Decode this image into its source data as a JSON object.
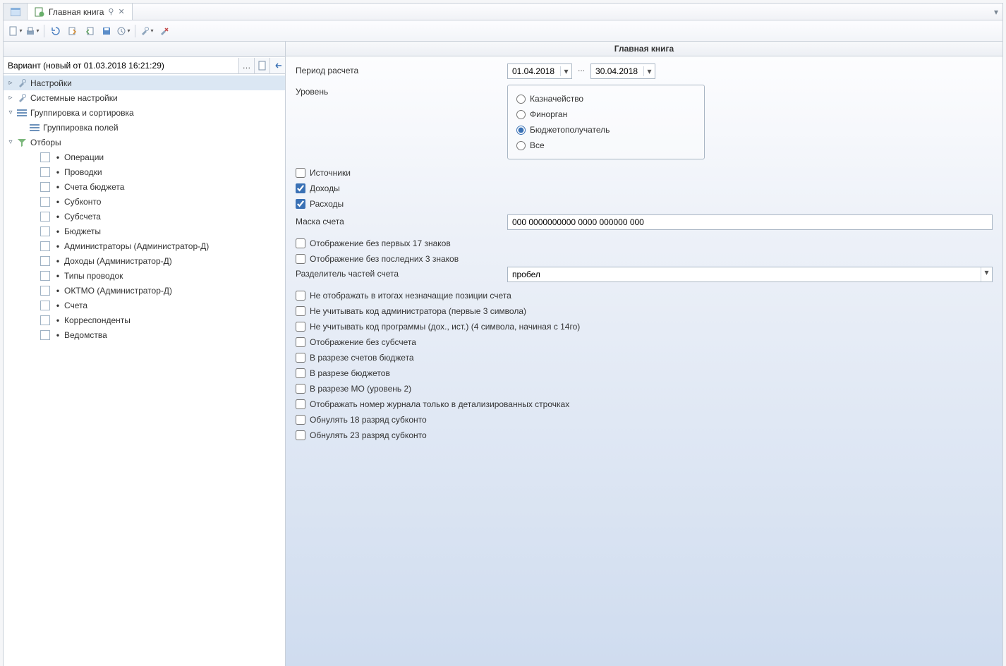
{
  "tab": {
    "title": "Главная книга"
  },
  "title": "Главная книга",
  "variant": {
    "value": "Вариант (новый от 01.03.2018 16:21:29)"
  },
  "tree": {
    "n_settings": "Настройки",
    "n_sys_settings": "Системные настройки",
    "n_group_sort": "Группировка и сортировка",
    "n_group_fields": "Группировка полей",
    "n_filters": "Отборы",
    "f_ops": "Операции",
    "f_entries": "Проводки",
    "f_budget_acc": "Счета бюджета",
    "f_subkonto": "Субконто",
    "f_subacc": "Субсчета",
    "f_budgets": "Бюджеты",
    "f_admins": "Администраторы (Администратор-Д)",
    "f_incomes": "Доходы (Администратор-Д)",
    "f_entry_types": "Типы проводок",
    "f_oktmo": "ОКТМО (Администратор-Д)",
    "f_accounts": "Счета",
    "f_corr": "Корреспонденты",
    "f_dept": "Ведомства"
  },
  "form": {
    "period_label": "Период расчета",
    "date_from": "01.04.2018",
    "date_to": "30.04.2018",
    "dots": "...",
    "level_label": "Уровень",
    "level": {
      "treasury": "Казначейство",
      "finorgan": "Финорган",
      "recipient": "Бюджетополучатель",
      "all": "Все"
    },
    "cb_sources": "Источники",
    "cb_incomes": "Доходы",
    "cb_expenses": "Расходы",
    "mask_label": "Маска счета",
    "mask_value": "000 0000000000 0000 000000 000",
    "cb_trim17": "Отображение без первых 17 знаков",
    "cb_trim3": "Отображение без последних 3 знаков",
    "sep_label": "Разделитель частей счета",
    "sep_value": "пробел",
    "cb_hide_ins": "Не отображать в итогах незначащие позиции счета",
    "cb_no_admin": "Не учитывать код администратора (первые 3 символа)",
    "cb_no_prog": "Не учитывать код программы (дох., ист.) (4 символа, начиная с 14го)",
    "cb_no_subacc": "Отображение без субсчета",
    "cb_by_budget_acc": "В разрезе счетов бюджета",
    "cb_by_budgets": "В разрезе бюджетов",
    "cb_by_mo": "В разрезе МО (уровень 2)",
    "cb_journal_detail": "Отображать номер журнала только в детализированных строчках",
    "cb_zero18": "Обнулять 18 разряд субконто",
    "cb_zero23": "Обнулять 23 разряд субконто"
  }
}
